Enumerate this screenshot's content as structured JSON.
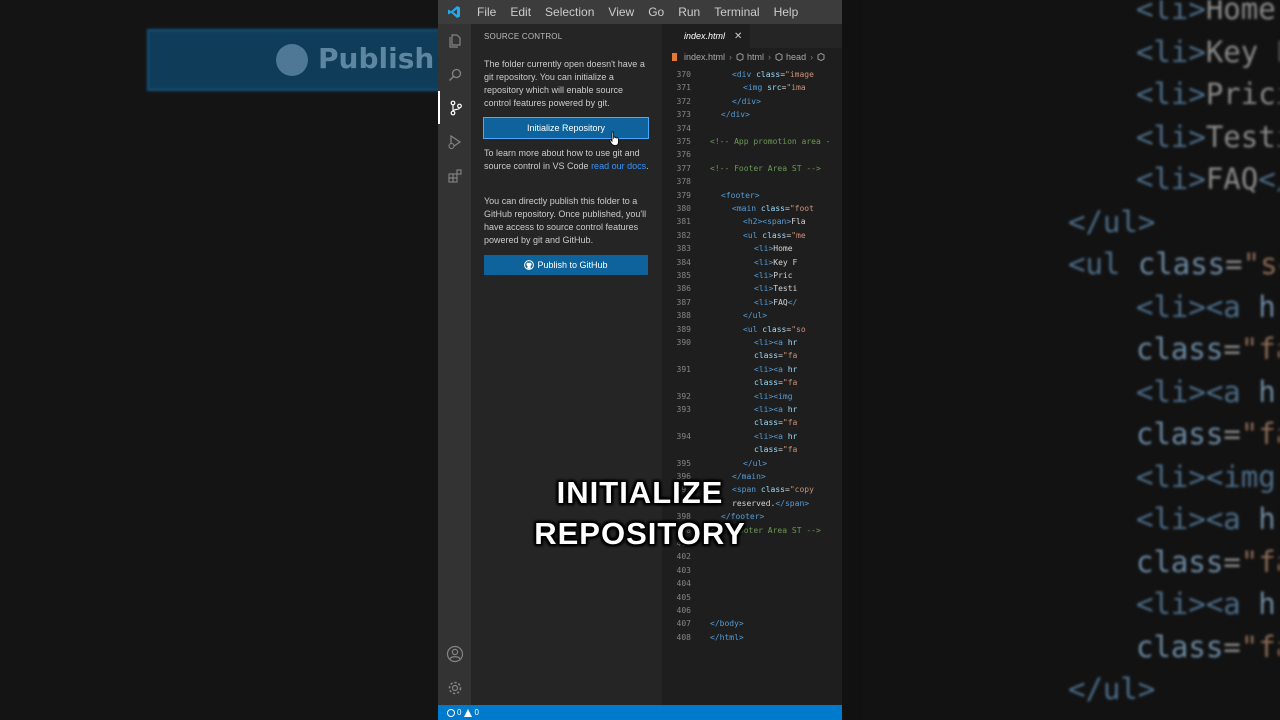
{
  "menu": [
    "File",
    "Edit",
    "Selection",
    "View",
    "Go",
    "Run",
    "Terminal",
    "Help"
  ],
  "activity_icons": [
    "explorer-icon",
    "search-icon",
    "source-control-icon",
    "run-debug-icon",
    "extensions-icon",
    "account-icon",
    "manage-gear-icon"
  ],
  "sidebar": {
    "title": "SOURCE CONTROL",
    "intro": "The folder currently open doesn't have a git repository. You can initialize a repository which will enable source control features powered by git.",
    "init_button": "Initialize Repository",
    "learn_prefix": "To learn more about how to use git and source control in VS Code ",
    "learn_link": "read our docs",
    "learn_suffix": ".",
    "publish_text": "You can directly publish this folder to a GitHub repository. Once published, you'll have access to source control features powered by git and GitHub.",
    "publish_button": "Publish to GitHub"
  },
  "editor": {
    "tab": "index.html",
    "tab_close": "✕",
    "breadcrumb": [
      "index.html",
      "html",
      "head"
    ],
    "lines": [
      {
        "n": "370",
        "t": [
          [
            "tg",
            "<div "
          ],
          [
            "at",
            "class"
          ],
          [
            "tx",
            "="
          ],
          [
            "st",
            "\"image"
          ]
        ],
        "i": 2
      },
      {
        "n": "371",
        "t": [
          [
            "tg",
            "<img "
          ],
          [
            "at",
            "src"
          ],
          [
            "tx",
            "="
          ],
          [
            "st",
            "\"ima"
          ]
        ],
        "i": 3
      },
      {
        "n": "372",
        "t": [
          [
            "tg",
            "</div>"
          ]
        ],
        "i": 2
      },
      {
        "n": "373",
        "t": [
          [
            "tg",
            "</div>"
          ]
        ],
        "i": 1
      },
      {
        "n": "374",
        "t": [],
        "i": 0
      },
      {
        "n": "375",
        "t": [
          [
            "cm",
            "<!-- App promotion area -"
          ]
        ],
        "i": 0
      },
      {
        "n": "376",
        "t": [],
        "i": 0
      },
      {
        "n": "377",
        "t": [
          [
            "cm",
            "<!-- Footer Area ST -->"
          ]
        ],
        "i": 0
      },
      {
        "n": "378",
        "t": [],
        "i": 0
      },
      {
        "n": "379",
        "t": [
          [
            "tg",
            "<footer>"
          ]
        ],
        "i": 1
      },
      {
        "n": "380",
        "t": [
          [
            "tg",
            "<main "
          ],
          [
            "at",
            "class"
          ],
          [
            "tx",
            "="
          ],
          [
            "st",
            "\"foot"
          ]
        ],
        "i": 2
      },
      {
        "n": "381",
        "t": [
          [
            "tg",
            "<h2><span>"
          ],
          [
            "tx",
            "Fla"
          ]
        ],
        "i": 3
      },
      {
        "n": "382",
        "t": [
          [
            "tg",
            "<ul "
          ],
          [
            "at",
            "class"
          ],
          [
            "tx",
            "="
          ],
          [
            "st",
            "\"me"
          ]
        ],
        "i": 3
      },
      {
        "n": "383",
        "t": [
          [
            "tg",
            "<li>"
          ],
          [
            "tx",
            "Home"
          ]
        ],
        "i": 4
      },
      {
        "n": "384",
        "t": [
          [
            "tg",
            "<li>"
          ],
          [
            "tx",
            "Key F"
          ]
        ],
        "i": 4
      },
      {
        "n": "385",
        "t": [
          [
            "tg",
            "<li>"
          ],
          [
            "tx",
            "Pric"
          ]
        ],
        "i": 4
      },
      {
        "n": "386",
        "t": [
          [
            "tg",
            "<li>"
          ],
          [
            "tx",
            "Testi"
          ]
        ],
        "i": 4
      },
      {
        "n": "387",
        "t": [
          [
            "tg",
            "<li>"
          ],
          [
            "tx",
            "FAQ"
          ],
          [
            "tg",
            "</"
          ]
        ],
        "i": 4
      },
      {
        "n": "388",
        "t": [
          [
            "tg",
            "</ul>"
          ]
        ],
        "i": 3
      },
      {
        "n": "389",
        "t": [
          [
            "tg",
            "<ul "
          ],
          [
            "at",
            "class"
          ],
          [
            "tx",
            "="
          ],
          [
            "st",
            "\"so"
          ]
        ],
        "i": 3
      },
      {
        "n": "390",
        "t": [
          [
            "tg",
            "<li><a "
          ],
          [
            "at",
            "hr"
          ]
        ],
        "i": 4
      },
      {
        "n": "",
        "t": [
          [
            "at",
            "class"
          ],
          [
            "tx",
            "="
          ],
          [
            "st",
            "\"fa"
          ]
        ],
        "i": 4
      },
      {
        "n": "391",
        "t": [
          [
            "tg",
            "<li><a "
          ],
          [
            "at",
            "hr"
          ]
        ],
        "i": 4
      },
      {
        "n": "",
        "t": [
          [
            "at",
            "class"
          ],
          [
            "tx",
            "="
          ],
          [
            "st",
            "\"fa"
          ]
        ],
        "i": 4
      },
      {
        "n": "392",
        "t": [
          [
            "tg",
            "<li><img "
          ]
        ],
        "i": 4
      },
      {
        "n": "393",
        "t": [
          [
            "tg",
            "<li><a "
          ],
          [
            "at",
            "hr"
          ]
        ],
        "i": 4
      },
      {
        "n": "",
        "t": [
          [
            "at",
            "class"
          ],
          [
            "tx",
            "="
          ],
          [
            "st",
            "\"fa"
          ]
        ],
        "i": 4
      },
      {
        "n": "394",
        "t": [
          [
            "tg",
            "<li><a "
          ],
          [
            "at",
            "hr"
          ]
        ],
        "i": 4
      },
      {
        "n": "",
        "t": [
          [
            "at",
            "class"
          ],
          [
            "tx",
            "="
          ],
          [
            "st",
            "\"fa"
          ]
        ],
        "i": 4
      },
      {
        "n": "395",
        "t": [
          [
            "tg",
            "</ul>"
          ]
        ],
        "i": 3
      },
      {
        "n": "396",
        "t": [
          [
            "tg",
            "</main>"
          ]
        ],
        "i": 2
      },
      {
        "n": "397",
        "t": [
          [
            "tg",
            "<span "
          ],
          [
            "at",
            "class"
          ],
          [
            "tx",
            "="
          ],
          [
            "st",
            "\"copy"
          ]
        ],
        "i": 2
      },
      {
        "n": "",
        "t": [
          [
            "tx",
            "reserved."
          ],
          [
            "tg",
            "</span>"
          ]
        ],
        "i": 2
      },
      {
        "n": "398",
        "t": [
          [
            "tg",
            "</footer>"
          ]
        ],
        "i": 1
      },
      {
        "n": "400",
        "t": [
          [
            "cm",
            "<!-- Footer Area ST -->"
          ]
        ],
        "i": 0
      },
      {
        "n": "401",
        "t": [],
        "i": 0
      },
      {
        "n": "402",
        "t": [],
        "i": 0
      },
      {
        "n": "403",
        "t": [],
        "i": 0
      },
      {
        "n": "404",
        "t": [],
        "i": 0
      },
      {
        "n": "405",
        "t": [],
        "i": 0
      },
      {
        "n": "406",
        "t": [],
        "i": 0
      },
      {
        "n": "407",
        "t": [
          [
            "tg",
            "</body>"
          ]
        ],
        "i": 0
      },
      {
        "n": "408",
        "t": [
          [
            "tg",
            "</html>"
          ]
        ],
        "i": 0
      }
    ]
  },
  "status": {
    "errors": "0",
    "warnings": "0"
  },
  "caption": {
    "line1": "INITIALIZE",
    "line2": "REPOSITORY"
  },
  "background_left": {
    "button_text": "Publish to"
  },
  "background_right": [
    [
      [
        "bg-tag",
        "<li>"
      ],
      [
        "bg-txt",
        "Home"
      ]
    ],
    [
      [
        "bg-tag",
        "<li>"
      ],
      [
        "bg-txt",
        "Key F"
      ]
    ],
    [
      [
        "bg-tag",
        "<li>"
      ],
      [
        "bg-txt",
        "Prici"
      ]
    ],
    [
      [
        "bg-tag",
        "<li>"
      ],
      [
        "bg-txt",
        "Testi"
      ]
    ],
    [
      [
        "bg-tag",
        "<li>"
      ],
      [
        "bg-txt",
        "FAQ"
      ],
      [
        "bg-tag",
        "</"
      ]
    ],
    [
      [
        "bg-tag",
        "</ul>"
      ]
    ],
    [
      [
        "bg-tag",
        "<ul "
      ],
      [
        "bg-attr",
        "class"
      ],
      [
        "bg-txt",
        "="
      ],
      [
        "bg-str",
        "\"so"
      ]
    ],
    [
      [
        "bg-tag",
        "<li><a "
      ],
      [
        "bg-attr",
        "hr"
      ]
    ],
    [
      [
        "bg-attr",
        "class"
      ],
      [
        "bg-txt",
        "="
      ],
      [
        "bg-str",
        "\"fa"
      ]
    ],
    [
      [
        "bg-tag",
        "<li><a "
      ],
      [
        "bg-attr",
        "hr"
      ]
    ],
    [
      [
        "bg-attr",
        "class"
      ],
      [
        "bg-txt",
        "="
      ],
      [
        "bg-str",
        "\"fa"
      ]
    ],
    [
      [
        "bg-tag",
        "<li><img"
      ]
    ],
    [
      [
        "bg-tag",
        "<li><a "
      ],
      [
        "bg-attr",
        "hr"
      ]
    ],
    [
      [
        "bg-attr",
        "class"
      ],
      [
        "bg-txt",
        "="
      ],
      [
        "bg-str",
        "\"fa"
      ]
    ],
    [
      [
        "bg-tag",
        "<li><a "
      ],
      [
        "bg-attr",
        "hr"
      ]
    ],
    [
      [
        "bg-attr",
        "class"
      ],
      [
        "bg-txt",
        "="
      ],
      [
        "bg-str",
        "\"fa"
      ]
    ],
    [
      [
        "bg-tag",
        "</ul>"
      ]
    ]
  ],
  "colors": {
    "accent": "#007acc",
    "button": "#0e639c",
    "link": "#3794ff"
  }
}
